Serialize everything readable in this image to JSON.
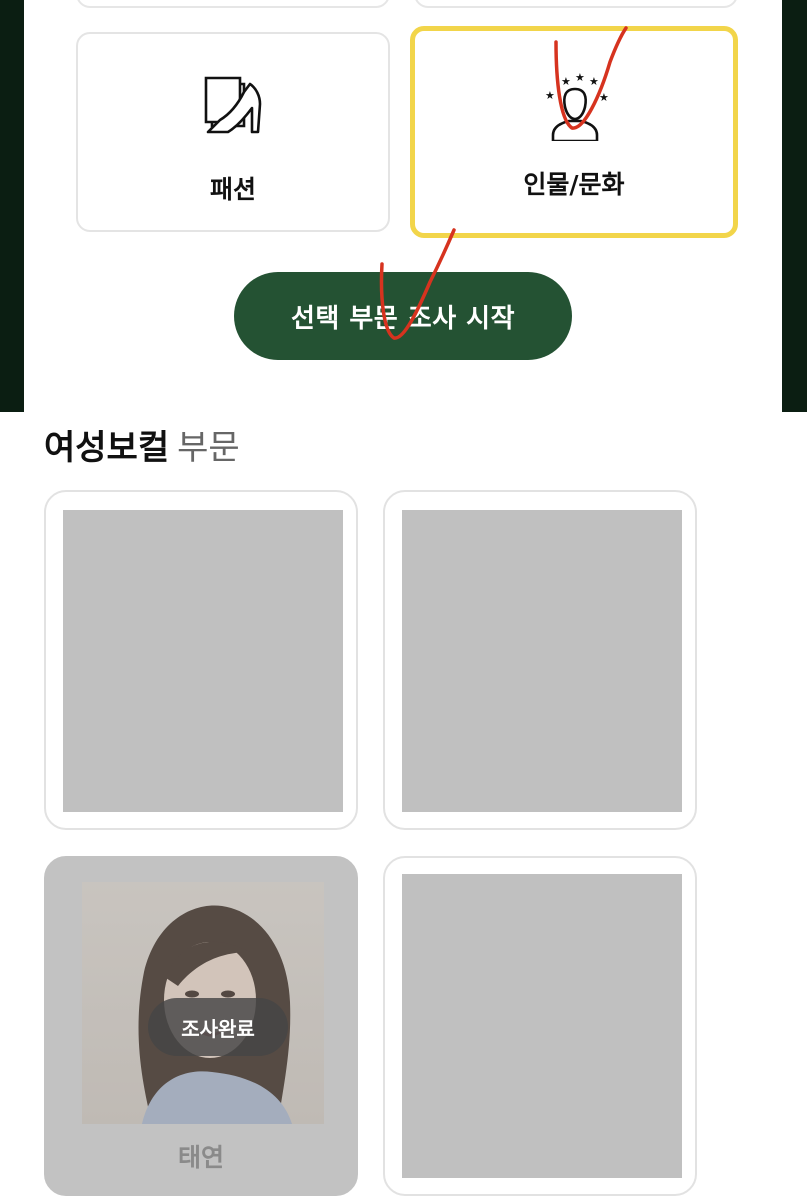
{
  "categories": [
    {
      "label": "패션",
      "icon": "fashion-icon",
      "selected": false
    },
    {
      "label": "인물/문화",
      "icon": "person-culture-icon",
      "selected": true
    }
  ],
  "start_button": {
    "label": "선택 부문 조사 시작"
  },
  "section": {
    "title": "여성보컬",
    "subtitle": "부문"
  },
  "candidates": [
    {
      "status": ""
    },
    {
      "status": ""
    },
    {
      "name": "태연",
      "status": "조사완료"
    },
    {
      "status": ""
    }
  ],
  "colors": {
    "accent_green": "#245233",
    "selected_border": "#f2d54a",
    "placeholder": "#c0c0c0",
    "annotation": "#d6331f"
  }
}
